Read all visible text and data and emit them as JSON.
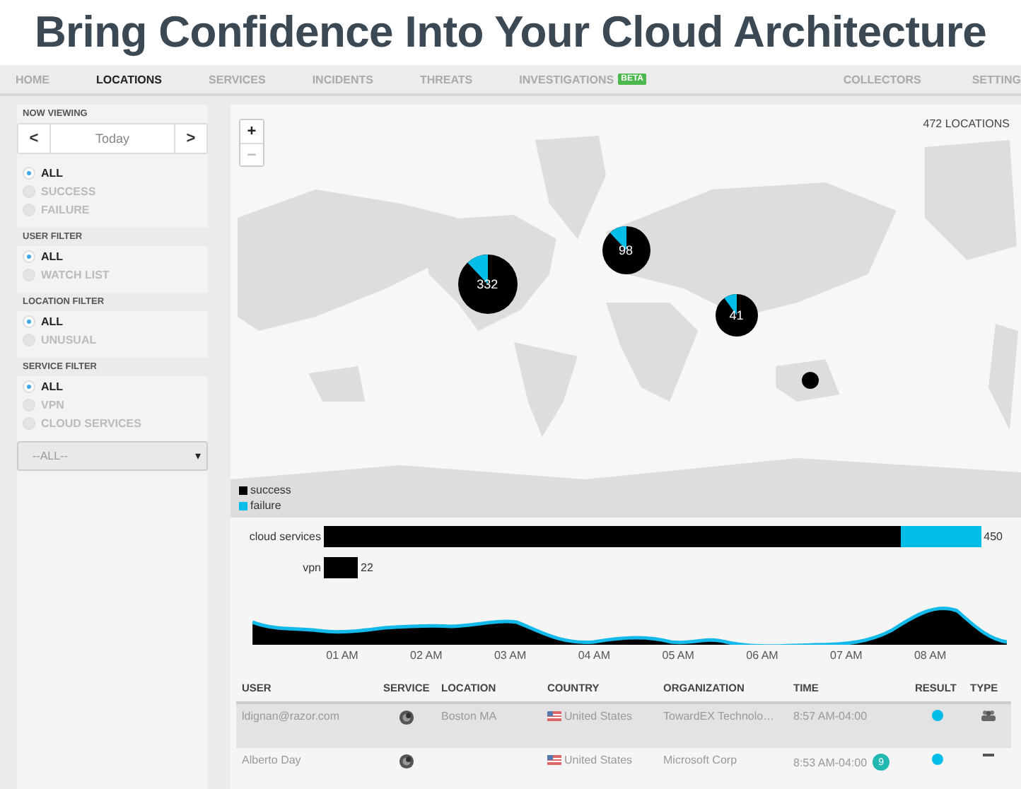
{
  "headline": "Bring Confidence Into Your Cloud Architecture",
  "nav": [
    {
      "label": "HOME",
      "selected": false
    },
    {
      "label": "LOCATIONS",
      "selected": true
    },
    {
      "label": "SERVICES",
      "selected": false
    },
    {
      "label": "INCIDENTS",
      "selected": false
    },
    {
      "label": "THREATS",
      "selected": false
    },
    {
      "label": "INVESTIGATIONS",
      "selected": false,
      "badge": "BETA"
    }
  ],
  "nav_right": [
    {
      "label": "COLLECTORS",
      "selected": false
    },
    {
      "label": "SETTING",
      "selected": false
    }
  ],
  "sidebar": {
    "now_viewing": {
      "title": "NOW VIEWING",
      "prev": "<",
      "date": "Today",
      "next": ">"
    },
    "sections": [
      {
        "options": [
          {
            "label": "ALL",
            "selected": true
          },
          {
            "label": "SUCCESS",
            "selected": false
          },
          {
            "label": "FAILURE",
            "selected": false
          }
        ]
      },
      {
        "title": "USER FILTER",
        "options": [
          {
            "label": "ALL",
            "selected": true
          },
          {
            "label": "WATCH LIST",
            "selected": false
          }
        ]
      },
      {
        "title": "LOCATION FILTER",
        "options": [
          {
            "label": "ALL",
            "selected": true
          },
          {
            "label": "UNUSUAL",
            "selected": false
          }
        ]
      },
      {
        "title": "SERVICE FILTER",
        "options": [
          {
            "label": "ALL",
            "selected": true
          },
          {
            "label": "VPN",
            "selected": false
          },
          {
            "label": "CLOUD SERVICES",
            "selected": false
          }
        ]
      }
    ],
    "dropdown": {
      "value": "--ALL--",
      "caret": "▾"
    }
  },
  "map": {
    "zoom_in": "+",
    "zoom_out": "−",
    "count": "472 LOCATIONS",
    "markers": [
      {
        "label": "332"
      },
      {
        "label": "98"
      },
      {
        "label": "41"
      }
    ],
    "legend": [
      {
        "label": "success",
        "color": "#000000"
      },
      {
        "label": "failure",
        "color": "#00bde8"
      }
    ]
  },
  "services": [
    {
      "label": "cloud services",
      "value": "450",
      "segments": [
        {
          "kind": "success"
        },
        {
          "kind": "failure"
        }
      ]
    },
    {
      "label": "vpn",
      "value": "22",
      "segments": [
        {
          "kind": "success"
        }
      ]
    }
  ],
  "timeline": {
    "ticks": [
      "01 AM",
      "02 AM",
      "03 AM",
      "04 AM",
      "05 AM",
      "06 AM",
      "07 AM",
      "08 AM"
    ]
  },
  "table": {
    "columns": [
      "USER",
      "SERVICE",
      "LOCATION",
      "COUNTRY",
      "ORGANIZATION",
      "TIME",
      "RESULT",
      "TYPE"
    ],
    "rows": [
      {
        "selected": true,
        "user": "ldignan@razor.com",
        "location": "Boston MA",
        "country": "United States",
        "organization": "TowardEX Technolo…",
        "time": "8:57 AM-04:00",
        "color": "#00bde8",
        "kind": "group"
      },
      {
        "selected": false,
        "user": "Alberto Day",
        "country": "United States",
        "organization": "Microsoft Corp",
        "time": "8:53 AM-04:00",
        "badge": "9",
        "color": "#00bde8",
        "kind": "none"
      }
    ]
  }
}
